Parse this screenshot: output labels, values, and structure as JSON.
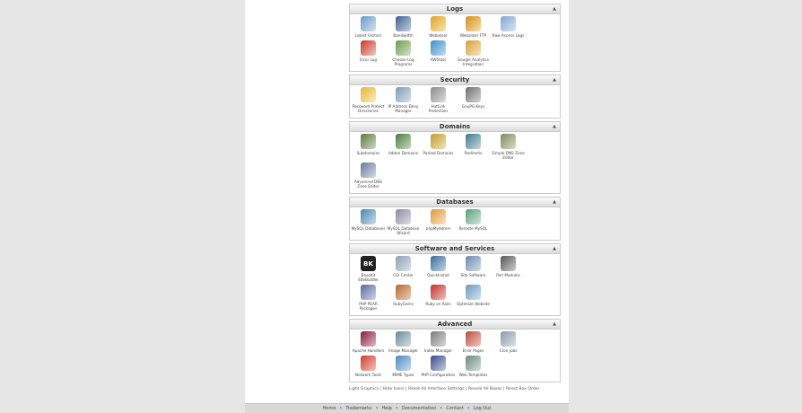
{
  "panels": [
    {
      "title": "Logs",
      "items": [
        {
          "label": "Latest Visitors",
          "icon": "latest-visitors-icon",
          "color": "#6a9ac9"
        },
        {
          "label": "Bandwidth",
          "icon": "bandwidth-icon",
          "color": "#3d5f8f"
        },
        {
          "label": "Webalizer",
          "icon": "webalizer-icon",
          "color": "#e0a21d"
        },
        {
          "label": "Webalizer FTP",
          "icon": "webalizer-ftp-icon",
          "color": "#d98f12"
        },
        {
          "label": "Raw Access Logs",
          "icon": "raw-access-logs-icon",
          "color": "#7fa7d1"
        },
        {
          "label": "Error Log",
          "icon": "error-log-icon",
          "color": "#c83a2a"
        },
        {
          "label": "Choose Log Programs",
          "icon": "choose-log-programs-icon",
          "color": "#6b9c4c"
        },
        {
          "label": "AWStats",
          "icon": "awstats-icon",
          "color": "#3c8ec7"
        },
        {
          "label": "Google Analytics Integration",
          "icon": "google-analytics-icon",
          "color": "#d8a036"
        }
      ]
    },
    {
      "title": "Security",
      "items": [
        {
          "label": "Password Protect Directories",
          "icon": "password-protect-icon",
          "color": "#e8b735"
        },
        {
          "label": "IP Address Deny Manager",
          "icon": "ip-deny-icon",
          "color": "#7d9ab5"
        },
        {
          "label": "HotLink Protection",
          "icon": "hotlink-icon",
          "color": "#8a8a8a"
        },
        {
          "label": "GnuPG Keys",
          "icon": "gnupg-keys-icon",
          "color": "#6f6f6f"
        }
      ]
    },
    {
      "title": "Domains",
      "items": [
        {
          "label": "Subdomains",
          "icon": "subdomains-icon",
          "color": "#5a7a3a"
        },
        {
          "label": "Addon Domains",
          "icon": "addon-domains-icon",
          "color": "#4a7a3a"
        },
        {
          "label": "Parked Domains",
          "icon": "parked-domains-icon",
          "color": "#c69b2c"
        },
        {
          "label": "Redirects",
          "icon": "redirects-icon",
          "color": "#3d7a8a"
        },
        {
          "label": "Simple DNS Zone Editor",
          "icon": "simple-dns-icon",
          "color": "#7a8a5a"
        },
        {
          "label": "Advanced DNS Zone Editor",
          "icon": "advanced-dns-icon",
          "color": "#6a7aa0"
        }
      ]
    },
    {
      "title": "Databases",
      "items": [
        {
          "label": "MySQL Databases",
          "icon": "mysql-databases-icon",
          "color": "#4a86b0"
        },
        {
          "label": "MySQL Database Wizard",
          "icon": "mysql-wizard-icon",
          "color": "#8a8aa0"
        },
        {
          "label": "phpMyAdmin",
          "icon": "phpmyadmin-icon",
          "color": "#e09a3a"
        },
        {
          "label": "Remote MySQL",
          "icon": "remote-mysql-icon",
          "color": "#5aa07a"
        }
      ]
    },
    {
      "title": "Software and Services",
      "items": [
        {
          "label": "BaseKit SiteBuilder",
          "icon": "basekit-icon",
          "color": "#222222",
          "glyph": "BK"
        },
        {
          "label": "CGI Center",
          "icon": "cgi-center-icon",
          "color": "#8aa0b5"
        },
        {
          "label": "QuickInstall",
          "icon": "quickinstall-icon",
          "color": "#3a6a9a"
        },
        {
          "label": "Site Software",
          "icon": "site-software-icon",
          "color": "#6a8ab0"
        },
        {
          "label": "Perl Modules",
          "icon": "perl-modules-icon",
          "color": "#555555"
        },
        {
          "label": "PHP PEAR Packages",
          "icon": "php-pear-icon",
          "color": "#5a6aa0"
        },
        {
          "label": "RubyGems",
          "icon": "rubygems-icon",
          "color": "#b5652a"
        },
        {
          "label": "Ruby on Rails",
          "icon": "ruby-on-rails-icon",
          "color": "#c0302a"
        },
        {
          "label": "Optimize Website",
          "icon": "optimize-website-icon",
          "color": "#6a9ac0"
        }
      ]
    },
    {
      "title": "Advanced",
      "items": [
        {
          "label": "Apache Handlers",
          "icon": "apache-handlers-icon",
          "color": "#8a1a3a"
        },
        {
          "label": "Image Manager",
          "icon": "image-manager-icon",
          "color": "#6a8a9a"
        },
        {
          "label": "Index Manager",
          "icon": "index-manager-icon",
          "color": "#7a7a7a"
        },
        {
          "label": "Error Pages",
          "icon": "error-pages-icon",
          "color": "#c04a3a"
        },
        {
          "label": "Cron Jobs",
          "icon": "cron-jobs-icon",
          "color": "#8a9aaa"
        },
        {
          "label": "Network Tools",
          "icon": "network-tools-icon",
          "color": "#d03a2a"
        },
        {
          "label": "MIME Types",
          "icon": "mime-types-icon",
          "color": "#4a8ac0"
        },
        {
          "label": "PHP Configuration",
          "icon": "php-configuration-icon",
          "color": "#3a4a8a"
        },
        {
          "label": "Web Templates",
          "icon": "web-templates-icon",
          "color": "#6a8a7a"
        }
      ]
    }
  ],
  "bottom_links": [
    "Light Graphics",
    "Hide Icons",
    "Reset All Interface Settings",
    "Reveal All Boxes",
    "Reset Box Order"
  ],
  "footer_links": [
    "Home",
    "Trademarks",
    "Help",
    "Documentation",
    "Contact",
    "Log Out"
  ],
  "collapse_glyph": "▲"
}
